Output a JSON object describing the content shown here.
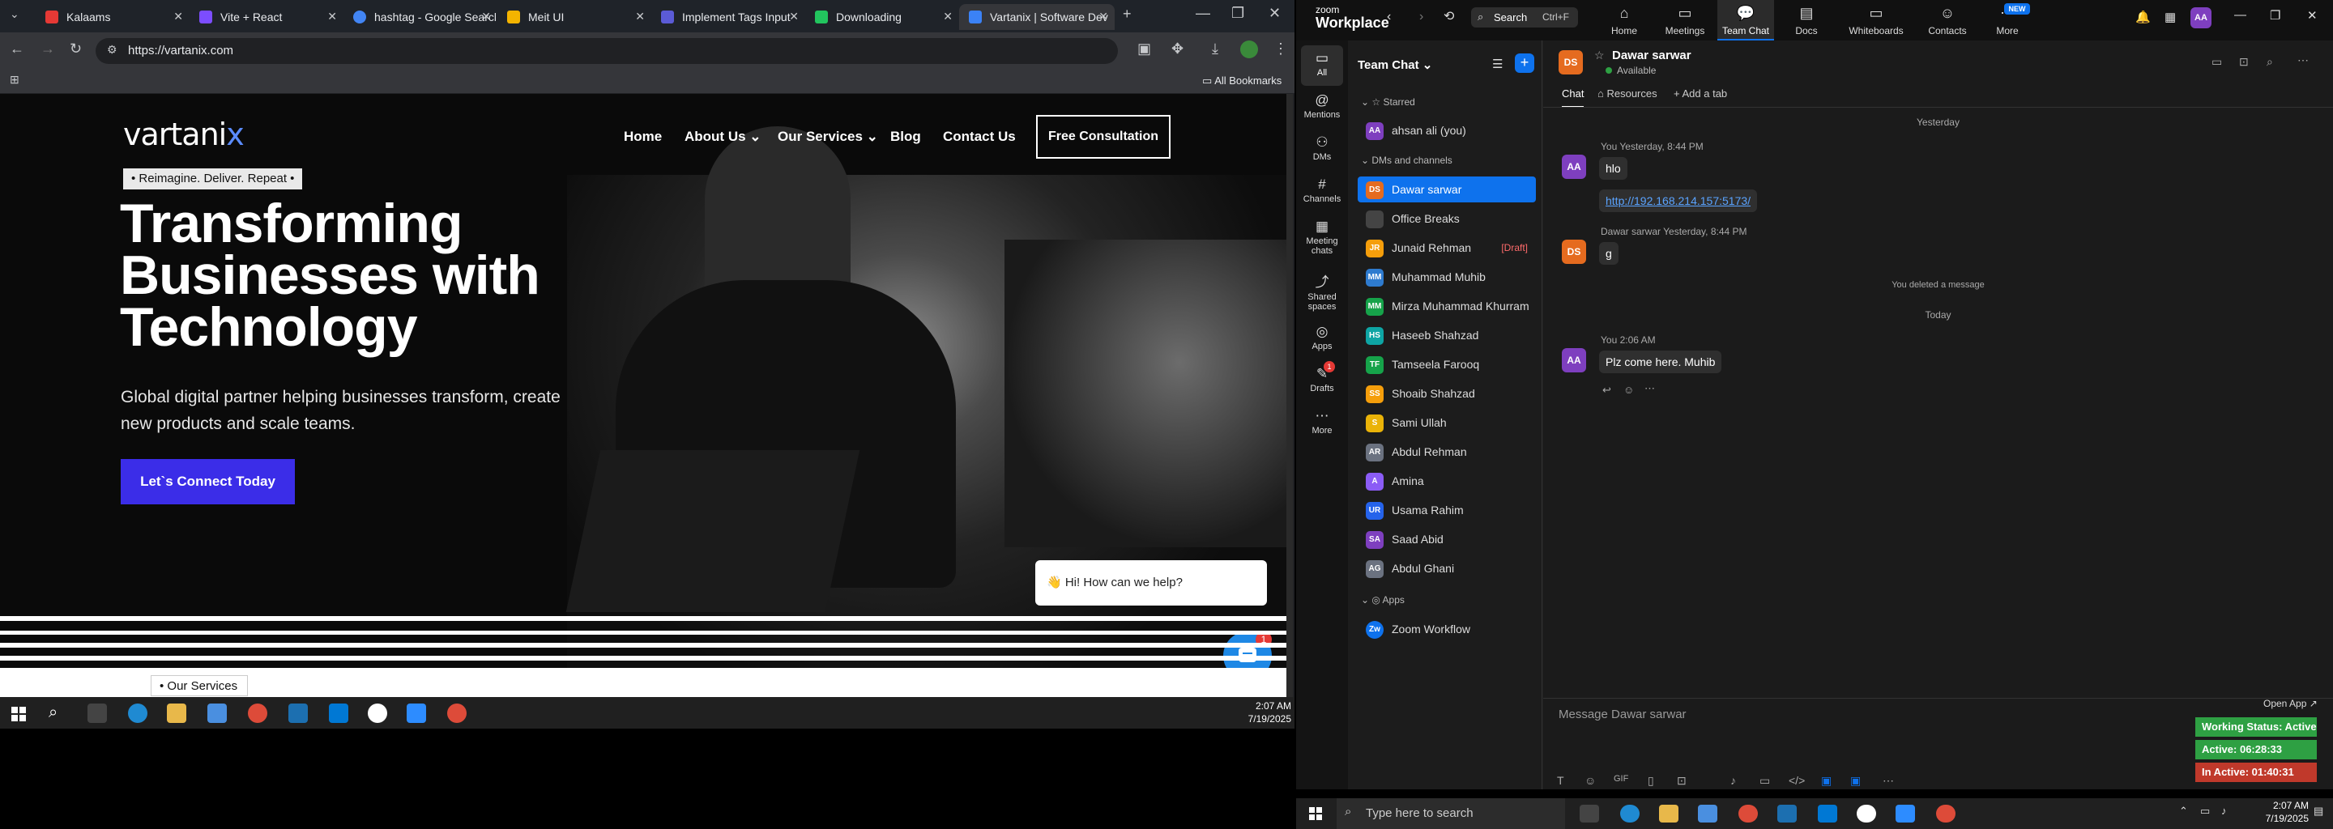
{
  "browser": {
    "tabs": [
      {
        "title": "Kalaams",
        "color": "#e53935"
      },
      {
        "title": "Vite + React",
        "color": "#7c4dff"
      },
      {
        "title": "hashtag - Google Search",
        "color": "#4285f4"
      },
      {
        "title": "Meit UI",
        "color": "#f4b400"
      },
      {
        "title": "Implement Tags Input",
        "color": "#5b5bd6"
      },
      {
        "title": "Downloading",
        "color": "#22c55e"
      },
      {
        "title": "Vartanix | Software Dev",
        "color": "#3b82f6"
      }
    ],
    "url": "https://vartanix.com",
    "all_bookmarks": "All Bookmarks"
  },
  "site": {
    "logo_text": "vartani",
    "logo_x": "x",
    "nav": {
      "home": "Home",
      "about": "About Us",
      "services": "Our Services",
      "blog": "Blog",
      "contact": "Contact Us",
      "consult": "Free Consultation"
    },
    "tagline": "• Reimagine. Deliver. Repeat •",
    "headline": [
      "Transforming",
      "Businesses with",
      "Technology"
    ],
    "subtitle": "Global digital partner helping businesses transform, create new products and scale teams.",
    "cta": "Let`s Connect Today",
    "chat_prompt": "👋 Hi! How can we help?",
    "chat_badge": "1",
    "services_tag": "• Our Services"
  },
  "left_taskbar": {
    "time": "2:07 AM",
    "date": "7/19/2025"
  },
  "zoom": {
    "brand_top": "zoom",
    "brand_bottom": "Workplace",
    "search": "Search",
    "search_shortcut": "Ctrl+F",
    "nav": [
      "Home",
      "Meetings",
      "Team Chat",
      "Docs",
      "Whiteboards",
      "Contacts",
      "More"
    ],
    "new_badge": "NEW",
    "user_initials": "AA",
    "rail": [
      "All",
      "Mentions",
      "DMs",
      "Channels",
      "Meeting chats",
      "Shared spaces",
      "Apps",
      "Drafts",
      "More"
    ],
    "drafts_badge": "1",
    "team_chat_title": "Team Chat",
    "sections": {
      "starred": "Starred",
      "dms": "DMs and channels",
      "apps": "Apps"
    },
    "starred": [
      {
        "name": "ahsan ali (you)",
        "initials": "AA",
        "color": "#7e3fbf"
      }
    ],
    "contacts": [
      {
        "name": "Dawar sarwar",
        "initials": "DS",
        "color": "#e56b1f",
        "draft": ""
      },
      {
        "name": "Office Breaks",
        "initials": "",
        "color": "#444444",
        "draft": ""
      },
      {
        "name": "Junaid Rehman",
        "initials": "JR",
        "color": "#f59e0b",
        "draft": "[Draft]"
      },
      {
        "name": "Muhammad Muhib",
        "initials": "MM",
        "color": "#2e7bcf",
        "draft": ""
      },
      {
        "name": "Mirza Muhammad Khurram",
        "initials": "MM",
        "color": "#16a34a",
        "draft": ""
      },
      {
        "name": "Haseeb Shahzad",
        "initials": "HS",
        "color": "#0ea5a4",
        "draft": ""
      },
      {
        "name": "Tamseela Farooq",
        "initials": "TF",
        "color": "#16a34a",
        "draft": ""
      },
      {
        "name": "Shoaib Shahzad",
        "initials": "SS",
        "color": "#f59e0b",
        "draft": ""
      },
      {
        "name": "Sami Ullah",
        "initials": "S",
        "color": "#eab308",
        "draft": ""
      },
      {
        "name": "Abdul Rehman",
        "initials": "AR",
        "color": "#6b7280",
        "draft": ""
      },
      {
        "name": "Amina",
        "initials": "A",
        "color": "#8b5cf6",
        "draft": ""
      },
      {
        "name": "Usama Rahim",
        "initials": "UR",
        "color": "#2563eb",
        "draft": ""
      },
      {
        "name": "Saad Abid",
        "initials": "SA",
        "color": "#7e3fbf",
        "draft": ""
      },
      {
        "name": "Abdul Ghani",
        "initials": "AG",
        "color": "#6b7280",
        "draft": ""
      }
    ],
    "apps": [
      {
        "name": "Zoom Workflow",
        "initials": "Zw",
        "color": "#0e72ed"
      }
    ],
    "chat": {
      "contact_name": "Dawar sarwar",
      "contact_initials": "DS",
      "status": "Available",
      "tabs": [
        "Chat",
        "Resources",
        "Add a tab"
      ],
      "day1": "Yesterday",
      "msg1_meta": "You Yesterday, 8:44 PM",
      "msg1_text": "hlo",
      "msg2_link": "http://192.168.214.157:5173/",
      "msg3_meta": "Dawar sarwar Yesterday, 8:44 PM",
      "msg3_text": "g",
      "deleted": "You deleted a message",
      "day2": "Today",
      "msg4_meta": "You 2:06 AM",
      "msg4_text": "Plz come here. Muhib",
      "composer_placeholder": "Message Dawar sarwar",
      "open_app": "Open App ↗",
      "status_working": "Working Status: Active",
      "status_active": "Active: 06:28:33",
      "status_inactive": "In Active: 01:40:31"
    }
  },
  "right_taskbar": {
    "search_placeholder": "Type here to search",
    "time": "2:07 AM",
    "date": "7/19/2025"
  },
  "colors": {
    "accent": "#0e72ed",
    "cta": "#3b2de8",
    "active_green": "#2ea043",
    "inactive_red": "#c0392b"
  }
}
